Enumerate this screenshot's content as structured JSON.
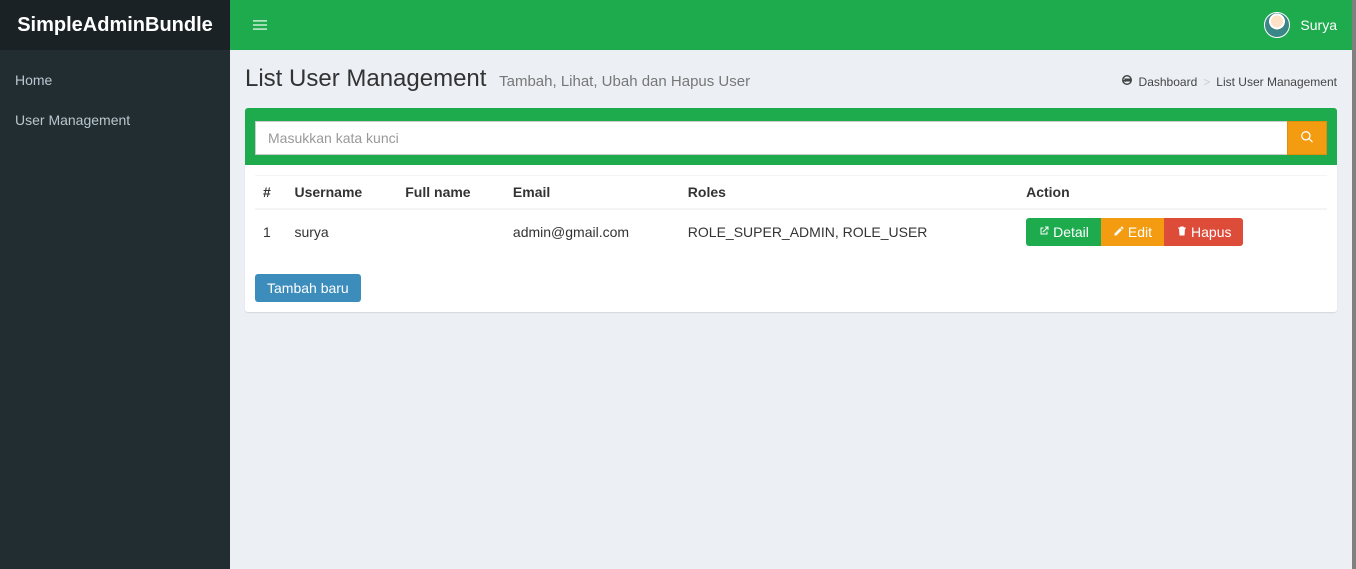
{
  "brand": "SimpleAdminBundle",
  "user": {
    "name": "Surya"
  },
  "sidebar": {
    "items": [
      {
        "label": "Home"
      },
      {
        "label": "User Management"
      }
    ]
  },
  "header": {
    "title": "List User Management",
    "subtitle": "Tambah, Lihat, Ubah dan Hapus User"
  },
  "breadcrumb": {
    "dashboard": "Dashboard",
    "current": "List User Management"
  },
  "search": {
    "placeholder": "Masukkan kata kunci"
  },
  "table": {
    "columns": [
      "#",
      "Username",
      "Full name",
      "Email",
      "Roles",
      "Action"
    ],
    "rows": [
      {
        "num": "1",
        "username": "surya",
        "fullname": "",
        "email": "admin@gmail.com",
        "roles": "ROLE_SUPER_ADMIN, ROLE_USER"
      }
    ]
  },
  "actions": {
    "detail": "Detail",
    "edit": "Edit",
    "delete": "Hapus"
  },
  "footer": {
    "add_new": "Tambah baru"
  }
}
